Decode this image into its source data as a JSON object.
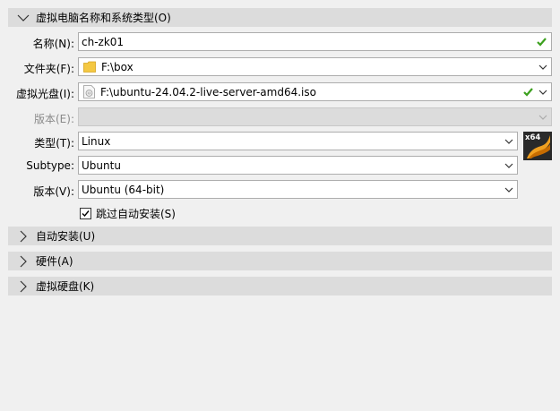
{
  "sections": {
    "name_os": "虚拟电脑名称和系统类型(O)",
    "unattended": "自动安装(U)",
    "hardware": "硬件(A)",
    "disk": "虚拟硬盘(K)"
  },
  "form": {
    "name": {
      "label": "名称(N):",
      "value": "ch-zk01"
    },
    "folder": {
      "label": "文件夹(F):",
      "value": "F:\\box"
    },
    "iso": {
      "label": "虚拟光盘(I):",
      "value": "F:\\ubuntu-24.04.2-live-server-amd64.iso"
    },
    "edition": {
      "label": "版本(E):",
      "value": ""
    },
    "type": {
      "label": "类型(T):",
      "value": "Linux"
    },
    "subtype": {
      "label": "Subtype:",
      "value": "Ubuntu"
    },
    "version": {
      "label": "版本(V):",
      "value": "Ubuntu (64-bit)"
    },
    "skip_unattended": {
      "label": "跳过自动安装(S)",
      "checked": true
    }
  },
  "os_icon": {
    "badge": "x64"
  },
  "colors": {
    "section_bg": "#dcdcdc",
    "valid_green": "#3ca01e",
    "folder_yellow": "#f4c842",
    "os_orange": "#f0a020"
  }
}
